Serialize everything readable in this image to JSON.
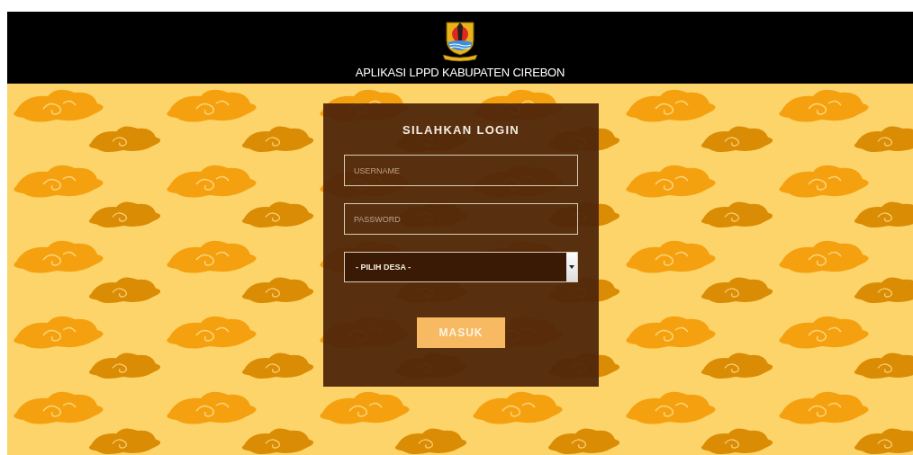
{
  "header": {
    "title": "APLIKASI LPPD KABUPATEN CIREBON"
  },
  "login": {
    "heading": "SILAHKAN LOGIN",
    "username": {
      "placeholder": "USERNAME"
    },
    "password": {
      "placeholder": "PASSWORD"
    },
    "village_select": {
      "value": "- PILIH DESA -"
    },
    "submit": "MASUK"
  }
}
